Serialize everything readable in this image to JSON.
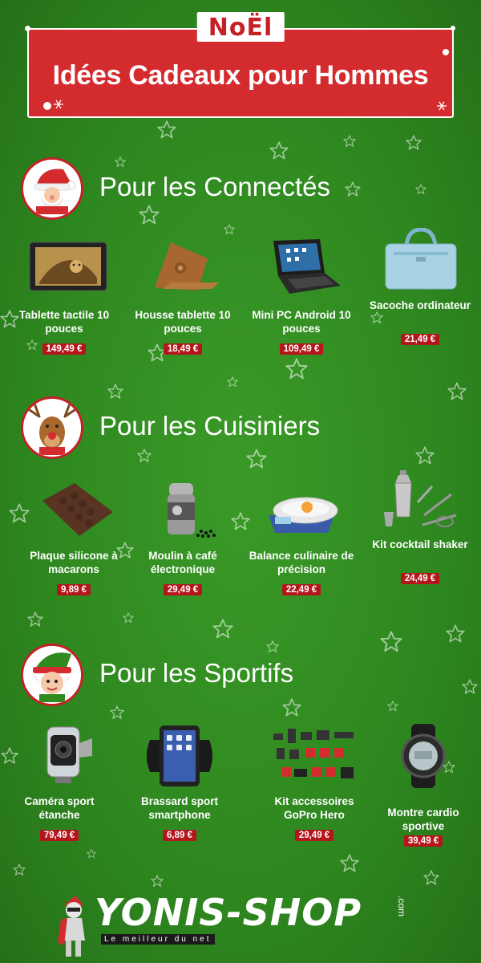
{
  "banner": {
    "tag": "NoËl",
    "title": "Idées Cadeaux pour Hommes"
  },
  "sections": [
    {
      "title": "Pour les Connectés",
      "avatar": "santa-icon",
      "items": [
        {
          "name": "Tablette tactile 10 pouces",
          "price": "149,49 €",
          "icon": "tablet-icon"
        },
        {
          "name": "Housse tablette 10 pouces",
          "price": "18,49 €",
          "icon": "tablet-case-icon"
        },
        {
          "name": "Mini PC Android 10 pouces",
          "price": "109,49 €",
          "icon": "laptop-icon"
        },
        {
          "name": "Sacoche ordinateur",
          "price": "21,49 €",
          "icon": "laptop-bag-icon"
        }
      ]
    },
    {
      "title": "Pour les Cuisiniers",
      "avatar": "reindeer-icon",
      "items": [
        {
          "name": "Plaque silicone à macarons",
          "price": "9,89 €",
          "icon": "silicone-mat-icon"
        },
        {
          "name": "Moulin à café électronique",
          "price": "29,49 €",
          "icon": "coffee-grinder-icon"
        },
        {
          "name": "Balance culinaire de précision",
          "price": "22,49 €",
          "icon": "kitchen-scale-icon"
        },
        {
          "name": "Kit cocktail shaker",
          "price": "24,49 €",
          "icon": "cocktail-shaker-icon"
        }
      ]
    },
    {
      "title": "Pour les Sportifs",
      "avatar": "elf-icon",
      "items": [
        {
          "name": "Caméra sport étanche",
          "price": "79,49 €",
          "icon": "action-camera-icon"
        },
        {
          "name": "Brassard sport smartphone",
          "price": "6,89 €",
          "icon": "armband-icon"
        },
        {
          "name": "Kit accessoires GoPro Hero",
          "price": "29,49 €",
          "icon": "gopro-accessories-icon"
        },
        {
          "name": "Montre cardio sportive",
          "price": "39,49 €",
          "icon": "sport-watch-icon"
        }
      ]
    }
  ],
  "footer": {
    "logo": "YONIS-SHOP",
    "tagline": "Le meilleur du net",
    "domain": ".com"
  },
  "colors": {
    "background": "#2f8a1f",
    "banner": "#d42b2f",
    "price_tag": "#b5161c"
  }
}
